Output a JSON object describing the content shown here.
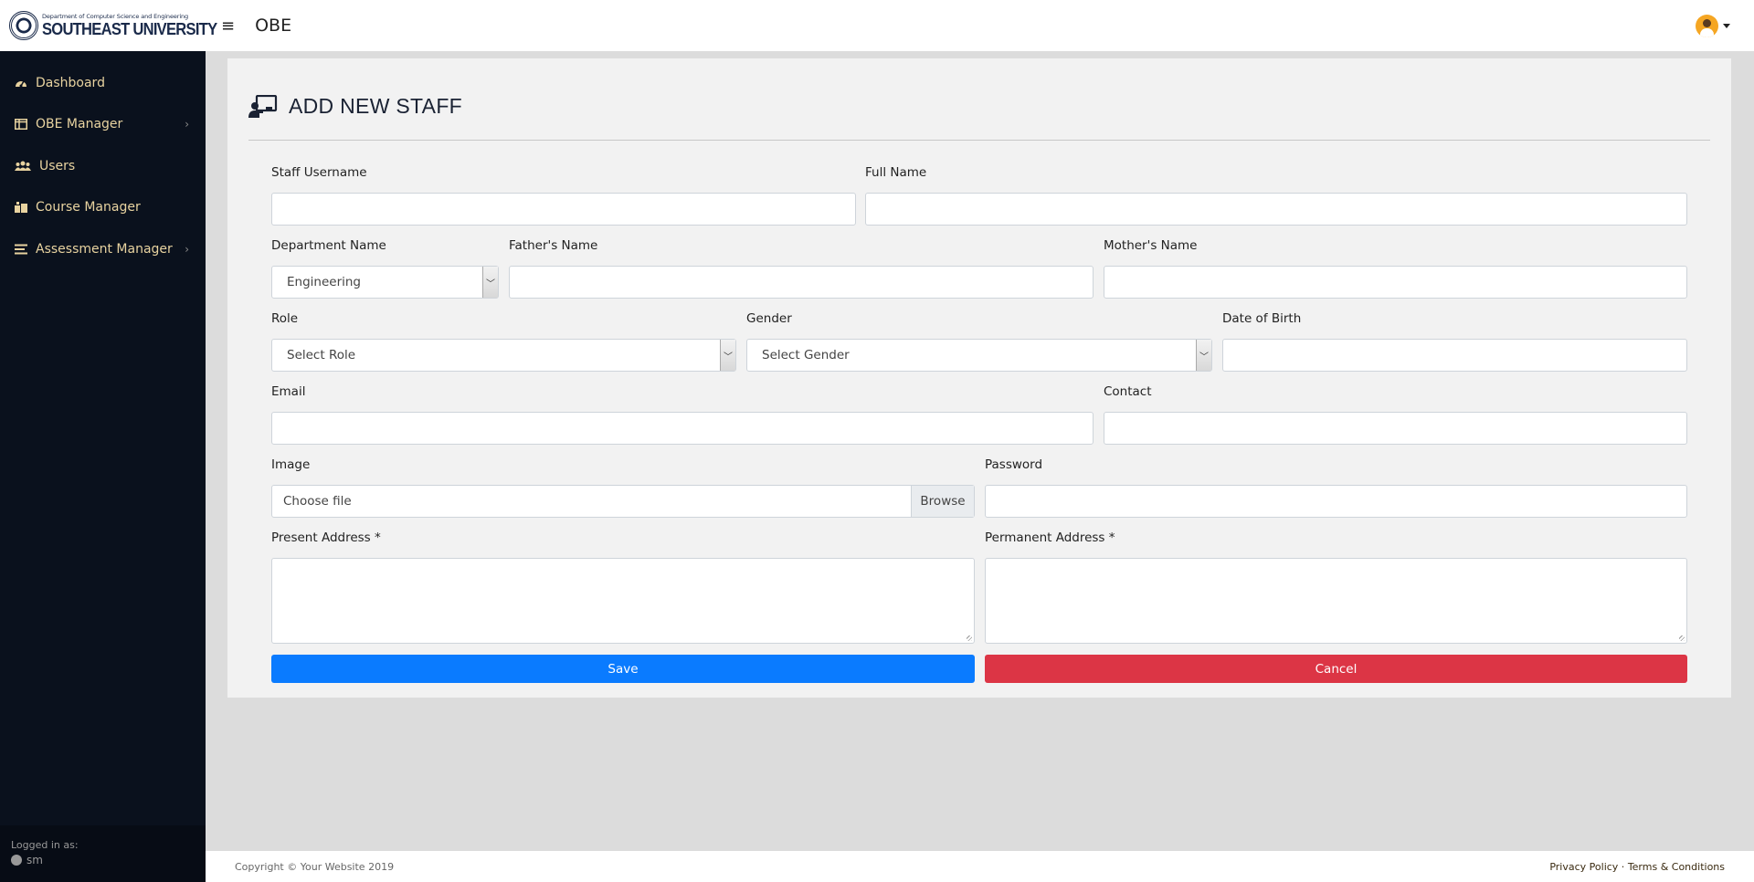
{
  "brand": {
    "subtitle": "Department of Computer Science and Engineering",
    "name": "SOUTHEAST UNIVERSITY"
  },
  "header": {
    "menu_icon": "≡",
    "title": "OBE"
  },
  "sidebar": {
    "items": [
      {
        "label": "Dashboard",
        "icon": "tachometer-icon",
        "has_submenu": false
      },
      {
        "label": "OBE Manager",
        "icon": "columns-icon",
        "has_submenu": true
      },
      {
        "label": "Users",
        "icon": "users-icon",
        "has_submenu": false
      },
      {
        "label": "Course Manager",
        "icon": "briefcase-icon",
        "has_submenu": false
      },
      {
        "label": "Assessment Manager",
        "icon": "list-icon",
        "has_submenu": true
      }
    ],
    "logged_in_label": "Logged in as:",
    "username": "sm"
  },
  "page": {
    "title": "ADD NEW STAFF"
  },
  "form": {
    "staff_username": {
      "label": "Staff Username",
      "value": ""
    },
    "full_name": {
      "label": "Full Name",
      "value": ""
    },
    "department": {
      "label": "Department Name",
      "selected": "Engineering"
    },
    "fathers_name": {
      "label": "Father's Name",
      "value": ""
    },
    "mothers_name": {
      "label": "Mother's Name",
      "value": ""
    },
    "role": {
      "label": "Role",
      "selected": "Select Role"
    },
    "gender": {
      "label": "Gender",
      "selected": "Select Gender"
    },
    "dob": {
      "label": "Date of Birth",
      "value": ""
    },
    "email": {
      "label": "Email",
      "value": ""
    },
    "contact": {
      "label": "Contact",
      "value": ""
    },
    "image": {
      "label": "Image",
      "placeholder": "Choose file",
      "browse": "Browse"
    },
    "password": {
      "label": "Password",
      "value": ""
    },
    "present_address": {
      "label": "Present Address *",
      "value": ""
    },
    "permanent_address": {
      "label": "Permanent Address *",
      "value": ""
    },
    "save_label": "Save",
    "cancel_label": "Cancel"
  },
  "footer": {
    "copyright": "Copyright © Your Website 2019",
    "privacy": "Privacy Policy",
    "separator": " · ",
    "terms": "Terms & Conditions"
  },
  "colors": {
    "sidebar_bg": "#0a111d",
    "sidebar_text": "#e8d3a0",
    "save": "#0a7bff",
    "cancel": "#dc3545"
  }
}
